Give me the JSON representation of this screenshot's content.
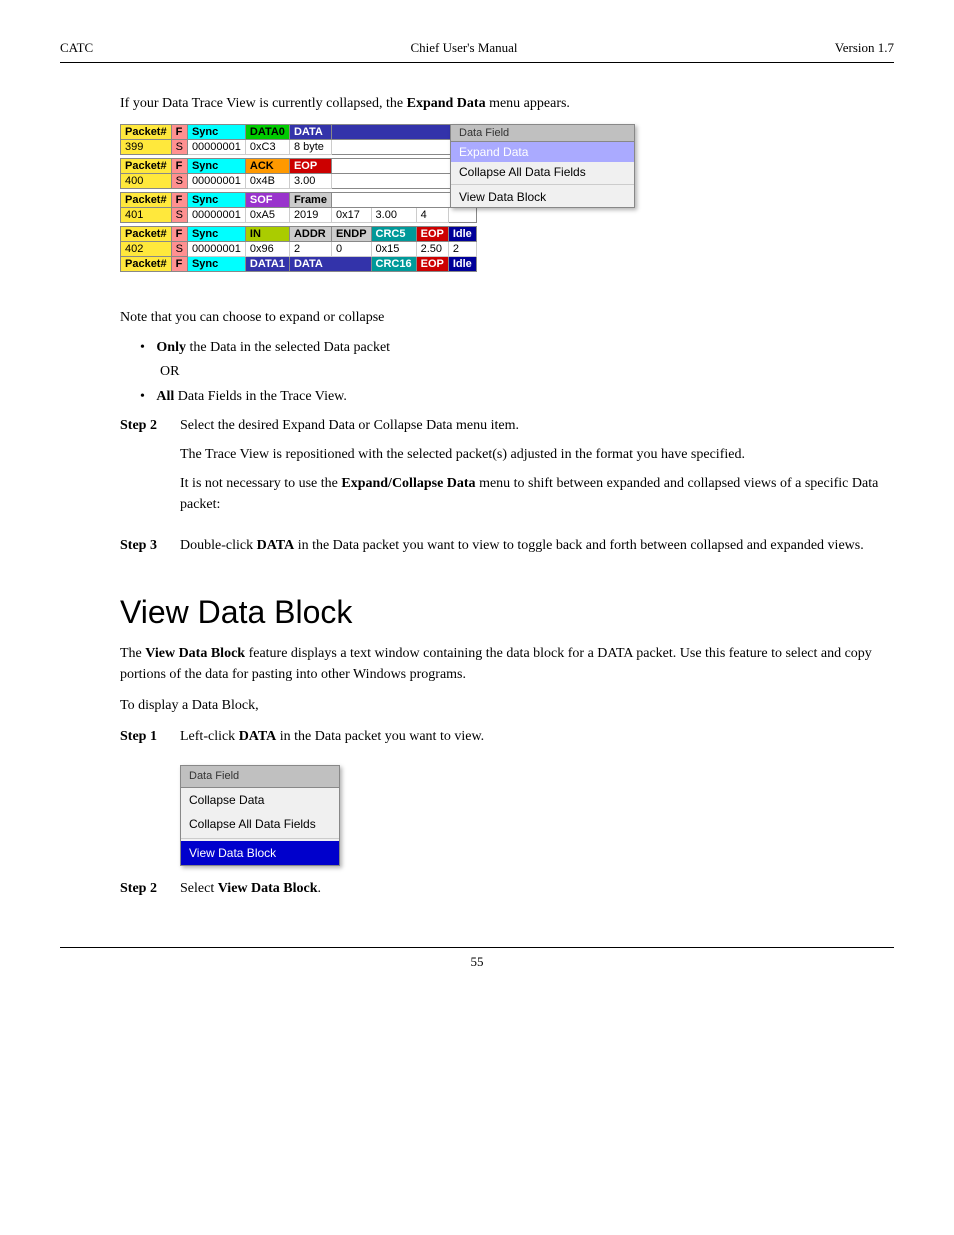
{
  "header": {
    "left": "CATC",
    "center": "Chief User's Manual",
    "right": "Version 1.7"
  },
  "intro": {
    "text1": "If your Data Trace View is currently collapsed, the ",
    "bold1": "Expand Data",
    "text2": " menu appears."
  },
  "trace": {
    "rows": [
      {
        "id": "399",
        "flag": "F",
        "s_flag": "S",
        "sync": "Sync",
        "col3": "DATA0",
        "col4": "DATA",
        "col5": "",
        "col6": "",
        "col7": "",
        "col8": "",
        "data_row_col3": "0xC3",
        "data_row_col4": "8 byte"
      },
      {
        "id": "400",
        "flag": "F",
        "s_flag": "S",
        "sync": "Sync",
        "col3": "ACK",
        "col4": "EOP",
        "col5": "",
        "data_row_col3": "0x4B",
        "data_row_col4": "3.00"
      },
      {
        "id": "401",
        "flag": "F",
        "s_flag": "S",
        "sync": "Sync",
        "col3": "SOF",
        "col4": "Frame",
        "data_row_col3": "0xA5",
        "data_row_col4": "2019"
      },
      {
        "id": "402",
        "flag": "F",
        "s_flag": "S",
        "sync": "Sync",
        "col3": "IN",
        "col4": "ADDR",
        "col5": "ENDP",
        "col6": "CRC5",
        "col7": "EOP",
        "col8": "Idle",
        "data_row_col3": "0x96",
        "data_row_col4": "2",
        "data_row_col5": "0",
        "data_row_col6": "0x15",
        "data_row_col7": "2.50",
        "data_row_col8": "2"
      }
    ],
    "last_row": "Packet#  F    Sync    DATA1       DATA            CRC16  EOP  Idle"
  },
  "context_menu1": {
    "title": "Data Field",
    "items": [
      {
        "label": "Expand Data",
        "selected": true
      },
      {
        "label": "Collapse All Data Fields",
        "selected": false
      },
      {
        "label": "",
        "divider": true
      },
      {
        "label": "View Data Block",
        "selected": false
      }
    ]
  },
  "note": {
    "text": "Note that you can choose to expand or collapse"
  },
  "bullets": [
    {
      "bold": "Only",
      "rest": " the Data in the selected Data packet"
    },
    {
      "or": "OR"
    },
    {
      "bold": "All",
      "rest": " Data Fields in the Trace View."
    }
  ],
  "steps_first": [
    {
      "label": "Step 2",
      "text": "Select the desired Expand Data or Collapse Data menu item."
    }
  ],
  "step2_body": [
    "The Trace View is repositioned with the selected packet(s) adjusted in the format you have specified.",
    "It is not necessary to use the {Expand/Collapse Data} menu to shift between expanded and collapsed views of a specific Data packet:"
  ],
  "step3": {
    "label": "Step 3",
    "text": "Double-click ",
    "bold": "DATA",
    "rest": " in the Data packet you want to view to toggle back and forth between collapsed and expanded views."
  },
  "section_heading": "View Data Block",
  "section_body1": "The ",
  "section_bold1": "View Data Block",
  "section_body1b": " feature displays a text window containing the data block for a DATA packet. Use this feature to select and copy portions of the data for pasting into other Windows programs.",
  "section_body2": "To display a Data Block,",
  "step1_vdb": {
    "label": "Step 1",
    "text": "Left-click ",
    "bold": "DATA",
    "rest": " in the Data packet you want to view."
  },
  "context_menu2": {
    "title": "Data Field",
    "items": [
      {
        "label": "Collapse Data"
      },
      {
        "label": "Collapse All Data Fields"
      },
      {
        "label": "",
        "divider": true
      },
      {
        "label": "View Data Block",
        "selected": true
      }
    ]
  },
  "step2_vdb": {
    "label": "Step 2",
    "text": "Select ",
    "bold": "View Data Block",
    "rest": "."
  },
  "footer": {
    "page": "55"
  }
}
